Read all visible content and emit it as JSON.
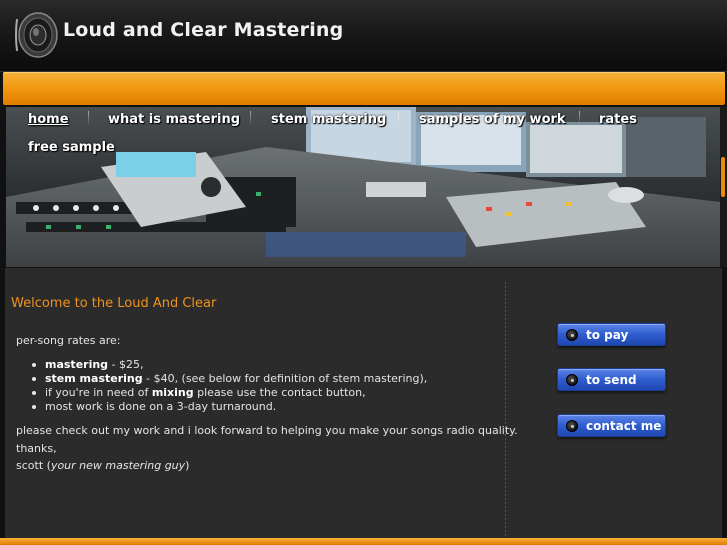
{
  "header": {
    "title": "Loud and Clear Mastering"
  },
  "nav": {
    "items": [
      {
        "label": "home"
      },
      {
        "label": "what is mastering"
      },
      {
        "label": "stem mastering"
      },
      {
        "label": "samples of my work"
      },
      {
        "label": "rates"
      },
      {
        "label": "free sample"
      }
    ]
  },
  "main": {
    "welcome": "Welcome to the Loud And Clear",
    "intro": "per-song rates are:",
    "list": [
      {
        "strong": "mastering",
        "rest": " - $25,"
      },
      {
        "strong": "stem mastering",
        "rest": " - $40, (see below for definition of stem mastering),"
      },
      {
        "pre": "if you're in need of ",
        "strong": "mixing",
        "rest": " please use the contact button,"
      },
      {
        "plain": "most work is done on a 3-day turnaround."
      }
    ],
    "closing": "please check out my work and i look forward to helping you make your songs radio quality.",
    "thanks": "thanks,",
    "sign_name": "scott (",
    "sign_tag": "your new mastering guy",
    "sign_end": ")"
  },
  "sidebar": {
    "buttons": [
      {
        "label": "to pay"
      },
      {
        "label": "to send"
      },
      {
        "label": "contact me"
      }
    ]
  },
  "colors": {
    "accent": "#f39a12",
    "welcome": "#f0921c",
    "button": "#2f5dcf"
  }
}
